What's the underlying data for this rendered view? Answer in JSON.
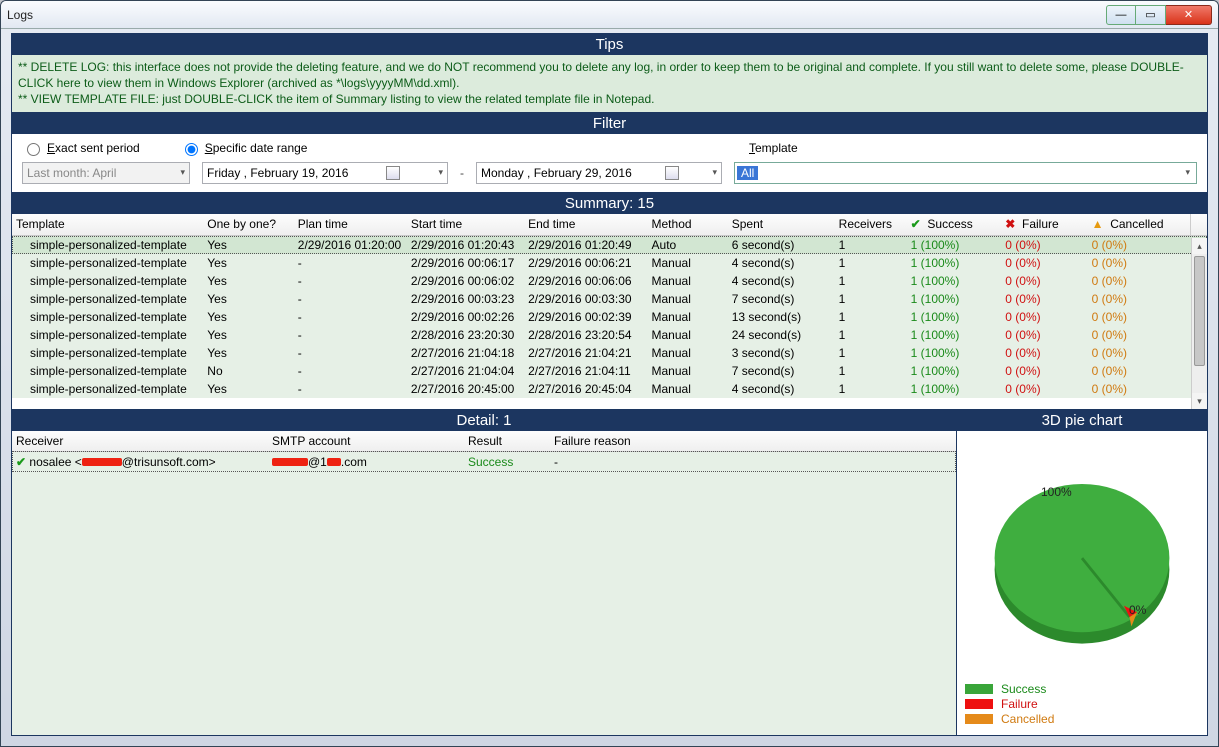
{
  "window": {
    "title": "Logs"
  },
  "tips": {
    "header": "Tips",
    "line1": "** DELETE LOG: this interface does not provide the deleting feature, and we do NOT recommend you to delete any log, in order to keep them to be original and complete. If you still want to delete some, please DOUBLE-CLICK here to view them in Windows Explorer (archived as *\\logs\\yyyyMM\\dd.xml).",
    "line2": "** VIEW TEMPLATE FILE: just DOUBLE-CLICK the item of Summary listing to view the related template file in Notepad."
  },
  "filter": {
    "header": "Filter",
    "exact_label_pre": "E",
    "exact_label_rest": "xact sent period",
    "specific_label_pre": "S",
    "specific_label_rest": "pecific date range",
    "template_label_pre": "T",
    "template_label_rest": "emplate",
    "period_value": "Last month: April",
    "date_from": "Friday    ,  February   19, 2016",
    "date_to": "Monday  ,  February   29, 2016",
    "template_value": "All",
    "specific_selected": true
  },
  "summary": {
    "header": "Summary: 15",
    "columns": {
      "template": "Template",
      "onebyone": "One by one?",
      "plan": "Plan time",
      "start": "Start time",
      "end": "End time",
      "method": "Method",
      "spent": "Spent",
      "receivers": "Receivers",
      "success": "Success",
      "failure": "Failure",
      "cancelled": "Cancelled"
    },
    "rows": [
      {
        "template": "simple-personalized-template",
        "one": "Yes",
        "plan": "2/29/2016 01:20:00",
        "start": "2/29/2016 01:20:43",
        "end": "2/29/2016 01:20:49",
        "method": "Auto",
        "spent": "6 second(s)",
        "recv": "1",
        "succ": "1 (100%)",
        "fail": "0 (0%)",
        "canc": "0 (0%)"
      },
      {
        "template": "simple-personalized-template",
        "one": "Yes",
        "plan": "-",
        "start": "2/29/2016 00:06:17",
        "end": "2/29/2016 00:06:21",
        "method": "Manual",
        "spent": "4 second(s)",
        "recv": "1",
        "succ": "1 (100%)",
        "fail": "0 (0%)",
        "canc": "0 (0%)"
      },
      {
        "template": "simple-personalized-template",
        "one": "Yes",
        "plan": "-",
        "start": "2/29/2016 00:06:02",
        "end": "2/29/2016 00:06:06",
        "method": "Manual",
        "spent": "4 second(s)",
        "recv": "1",
        "succ": "1 (100%)",
        "fail": "0 (0%)",
        "canc": "0 (0%)"
      },
      {
        "template": "simple-personalized-template",
        "one": "Yes",
        "plan": "-",
        "start": "2/29/2016 00:03:23",
        "end": "2/29/2016 00:03:30",
        "method": "Manual",
        "spent": "7 second(s)",
        "recv": "1",
        "succ": "1 (100%)",
        "fail": "0 (0%)",
        "canc": "0 (0%)"
      },
      {
        "template": "simple-personalized-template",
        "one": "Yes",
        "plan": "-",
        "start": "2/29/2016 00:02:26",
        "end": "2/29/2016 00:02:39",
        "method": "Manual",
        "spent": "13 second(s)",
        "recv": "1",
        "succ": "1 (100%)",
        "fail": "0 (0%)",
        "canc": "0 (0%)"
      },
      {
        "template": "simple-personalized-template",
        "one": "Yes",
        "plan": "-",
        "start": "2/28/2016 23:20:30",
        "end": "2/28/2016 23:20:54",
        "method": "Manual",
        "spent": "24 second(s)",
        "recv": "1",
        "succ": "1 (100%)",
        "fail": "0 (0%)",
        "canc": "0 (0%)"
      },
      {
        "template": "simple-personalized-template",
        "one": "Yes",
        "plan": "-",
        "start": "2/27/2016 21:04:18",
        "end": "2/27/2016 21:04:21",
        "method": "Manual",
        "spent": "3 second(s)",
        "recv": "1",
        "succ": "1 (100%)",
        "fail": "0 (0%)",
        "canc": "0 (0%)"
      },
      {
        "template": "simple-personalized-template",
        "one": "No",
        "plan": "-",
        "start": "2/27/2016 21:04:04",
        "end": "2/27/2016 21:04:11",
        "method": "Manual",
        "spent": "7 second(s)",
        "recv": "1",
        "succ": "1 (100%)",
        "fail": "0 (0%)",
        "canc": "0 (0%)"
      },
      {
        "template": "simple-personalized-template",
        "one": "Yes",
        "plan": "-",
        "start": "2/27/2016 20:45:00",
        "end": "2/27/2016 20:45:04",
        "method": "Manual",
        "spent": "4 second(s)",
        "recv": "1",
        "succ": "1 (100%)",
        "fail": "0 (0%)",
        "canc": "0 (0%)"
      }
    ]
  },
  "detail": {
    "header": "Detail: 1",
    "columns": {
      "receiver": "Receiver",
      "smtp": "SMTP account",
      "result": "Result",
      "reason": "Failure reason"
    },
    "rows": [
      {
        "receiver_pre": "nosalee <",
        "receiver_post": "@trisunsoft.com>",
        "smtp_post": "@1",
        "smtp_end": ".com",
        "result": "Success",
        "reason": "-"
      }
    ]
  },
  "chart": {
    "header": "3D pie chart",
    "label_100": "100%",
    "label_0": "0%",
    "legend": {
      "success": "Success",
      "failure": "Failure",
      "cancelled": "Cancelled"
    },
    "colors": {
      "success": "#39a539",
      "failure": "#ee1010",
      "cancelled": "#e58a1a"
    }
  },
  "chart_data": {
    "type": "pie",
    "categories": [
      "Success",
      "Failure",
      "Cancelled"
    ],
    "values": [
      100,
      0,
      0
    ],
    "title": "3D pie chart"
  }
}
